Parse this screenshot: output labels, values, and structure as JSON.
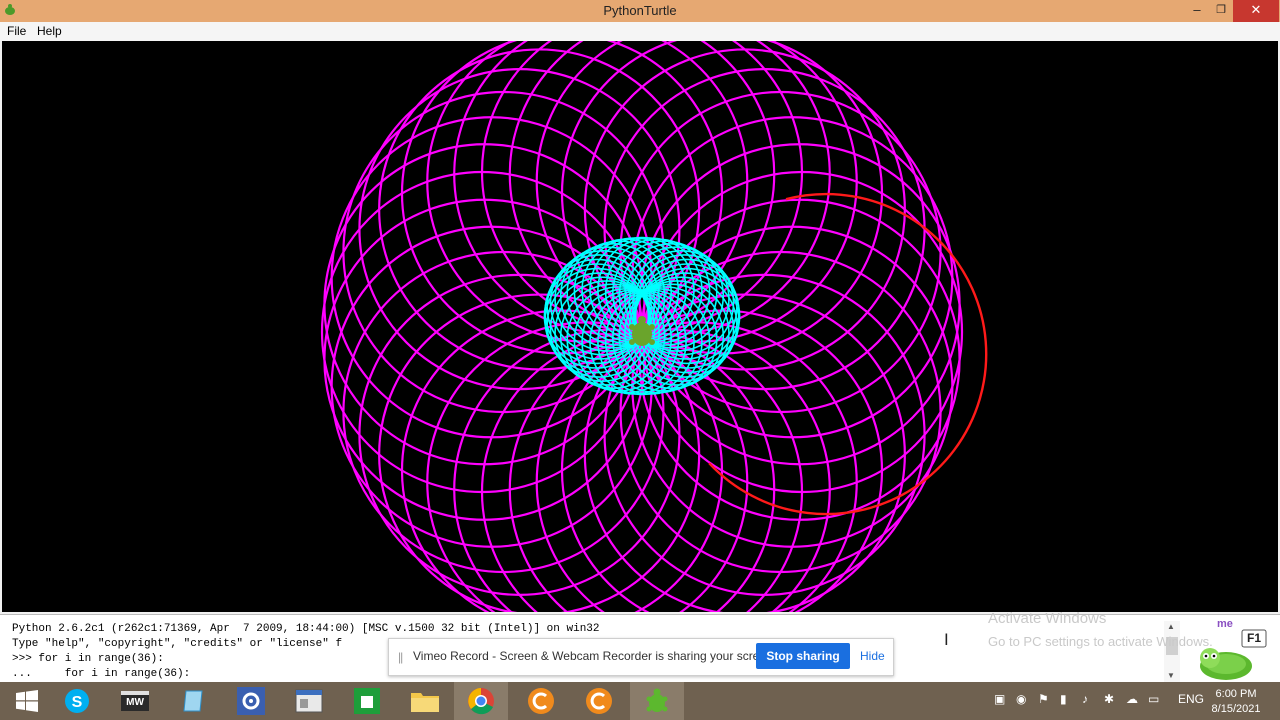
{
  "window": {
    "title": "PythonTurtle"
  },
  "menu": [
    "File",
    "Help"
  ],
  "controls": {
    "minimize": "–",
    "maximize": "❐",
    "close": "✕"
  },
  "shell": {
    "lines": [
      "Python 2.6.2c1 (r262c1:71369, Apr  7 2009, 18:44:00) [MSC v.1500 32 bit (Intel)] on win32",
      "Type \"help\", \"copyright\", \"credits\" or \"license\" f",
      ">>> for i in range(36):",
      "...     for i in range(36):"
    ]
  },
  "watermark": {
    "line1": "Activate Windows",
    "line2": "Go to PC settings to activate Windows."
  },
  "notification": {
    "message": "Vimeo Record - Screen & Webcam Recorder is sharing your screen.",
    "stop_label": "Stop sharing",
    "hide_label": "Hide"
  },
  "turtle_logo": {
    "key_label": "F1",
    "text": "me"
  },
  "taskbar": {
    "apps": [
      "windows-start-icon",
      "skype-icon",
      "moviemaker-icon",
      "notepad-icon",
      "settings-gear-icon",
      "window-app-icon",
      "store-icon",
      "folder-icon",
      "chrome-icon",
      "c-app-icon",
      "c-app-icon-2",
      "pythonturtle-icon"
    ],
    "mw_label": "MW",
    "language": "ENG",
    "time": "6:00 PM",
    "date": "8/15/2021"
  },
  "colors": {
    "outer_curves": "#ff00ff",
    "inner_curves": "#00ffff",
    "partial_curve": "#ff1a1a",
    "titlebar": "#e6a872",
    "taskbar": "#6f6150"
  }
}
